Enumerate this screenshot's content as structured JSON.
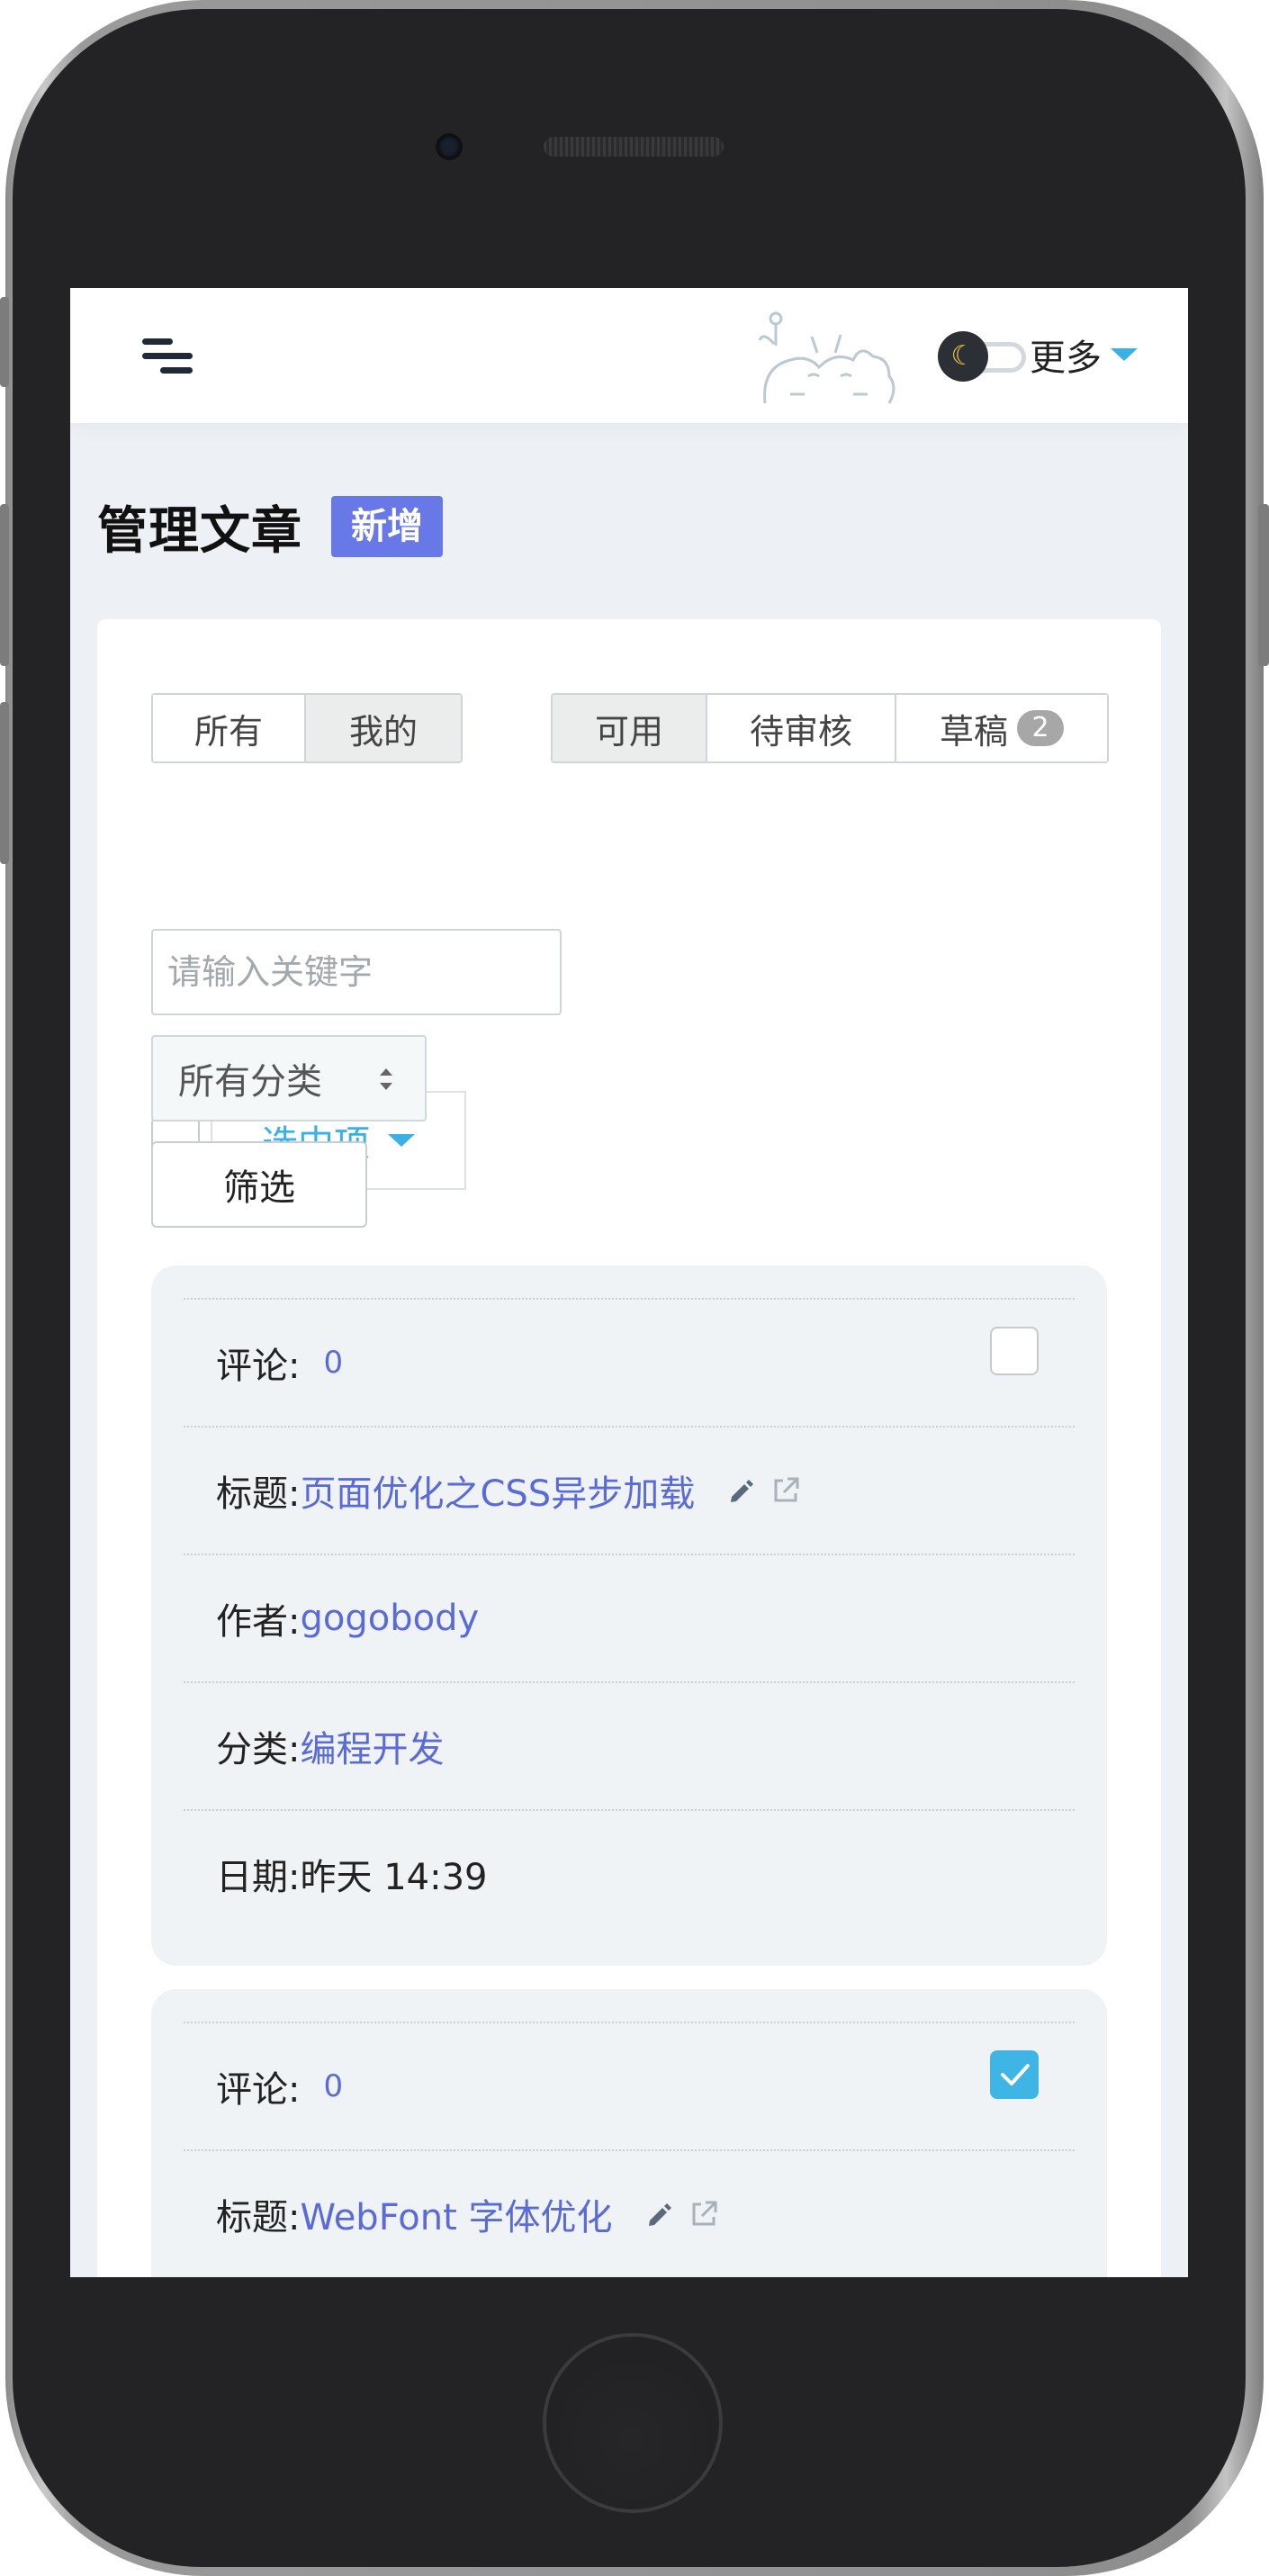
{
  "header": {
    "more_label": "更多",
    "theme_icon": "moon-icon",
    "accent_color": "#39b1e8"
  },
  "page": {
    "title": "管理文章",
    "add_label": "新增",
    "add_color": "#6878e6"
  },
  "filters": {
    "scope_tabs": [
      {
        "label": "所有",
        "active": false
      },
      {
        "label": "我的",
        "active": true
      }
    ],
    "status_tabs": [
      {
        "label": "可用",
        "active": true
      },
      {
        "label": "待审核",
        "active": false
      },
      {
        "label": "草稿",
        "active": false,
        "badge": "2"
      }
    ],
    "bulk_select_label": "选中项",
    "keyword_placeholder": "请输入关键字",
    "category_value": "所有分类",
    "filter_button": "筛选"
  },
  "posts": [
    {
      "checked": false,
      "comments_label": "评论:",
      "comments": "0",
      "title_label": "标题:",
      "title": "页面优化之CSS异步加载",
      "author_label": "作者:",
      "author": "gogobody",
      "category_label": "分类:",
      "category": "编程开发",
      "date_label": "日期:",
      "date": "昨天 14:39"
    },
    {
      "checked": true,
      "comments_label": "评论:",
      "comments": "0",
      "title_label": "标题:",
      "title": "WebFont 字体优化"
    }
  ]
}
